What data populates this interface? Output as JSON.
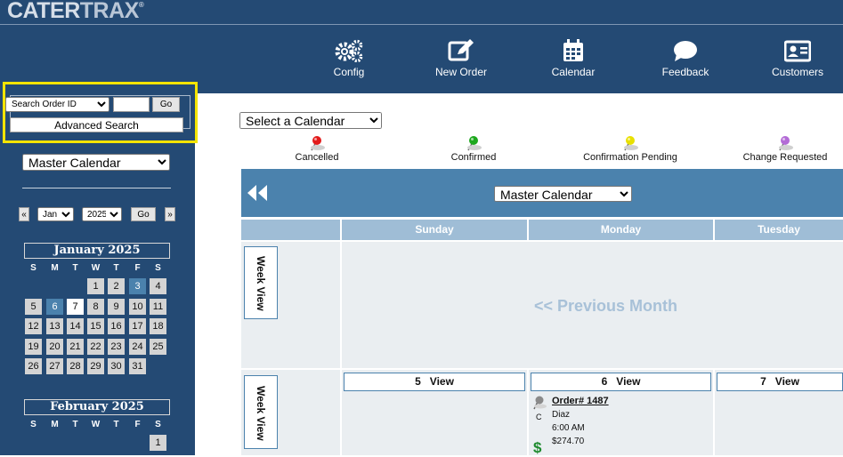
{
  "logo": {
    "cater": "CATER",
    "trax": "TRAX",
    "reg": "®"
  },
  "nav": [
    {
      "label": "Config"
    },
    {
      "label": "New Order"
    },
    {
      "label": "Calendar"
    },
    {
      "label": "Feedback"
    },
    {
      "label": "Customers"
    }
  ],
  "search": {
    "order_select": "Search Order ID",
    "order_input_value": "",
    "go_label": "Go",
    "advanced_label": "Advanced Search"
  },
  "sidebar": {
    "calendar_select": "Master Calendar",
    "prev_label": "«",
    "next_label": "»",
    "month_select": "Jan",
    "year_select": "2025",
    "go_label": "Go",
    "dow": [
      "S",
      "M",
      "T",
      "W",
      "T",
      "F",
      "S"
    ],
    "january_title": "January 2025",
    "february_title": "February 2025",
    "january_weeks": [
      [
        "",
        "",
        "",
        "1",
        "2",
        "3",
        "4"
      ],
      [
        "5",
        "6",
        "7",
        "8",
        "9",
        "10",
        "11"
      ],
      [
        "12",
        "13",
        "14",
        "15",
        "16",
        "17",
        "18"
      ],
      [
        "19",
        "20",
        "21",
        "22",
        "23",
        "24",
        "25"
      ],
      [
        "26",
        "27",
        "28",
        "29",
        "30",
        "31",
        ""
      ]
    ],
    "february_weeks": [
      [
        "",
        "",
        "",
        "",
        "",
        "",
        "1"
      ]
    ]
  },
  "main": {
    "calendar_select": "Select a Calendar",
    "legend": [
      {
        "label": "Cancelled",
        "color": "#e31b1b"
      },
      {
        "label": "Confirmed",
        "color": "#1ea81e"
      },
      {
        "label": "Confirmation Pending",
        "color": "#e8e000"
      },
      {
        "label": "Change Requested",
        "color": "#b36bd6"
      }
    ],
    "banner_select": "Master Calendar",
    "day_headers": [
      "Sunday",
      "Monday",
      "Tuesday"
    ],
    "week_view_label": "Week View",
    "previous_month": "<< Previous Month",
    "day_views": [
      {
        "day": "5",
        "label": "View"
      },
      {
        "day": "6",
        "label": "View"
      },
      {
        "day": "7",
        "label": "View"
      }
    ],
    "order": {
      "link": "Order# 1487",
      "status": "C",
      "customer": "Diaz",
      "time": "6:00 AM",
      "amount": "$274.70",
      "paid_icon": "$"
    }
  },
  "colors": {
    "nav_bg": "#244a74",
    "accent_blue": "#4b82ad",
    "header_blue": "#9fbdd6",
    "highlight_yellow": "#f4e400"
  }
}
